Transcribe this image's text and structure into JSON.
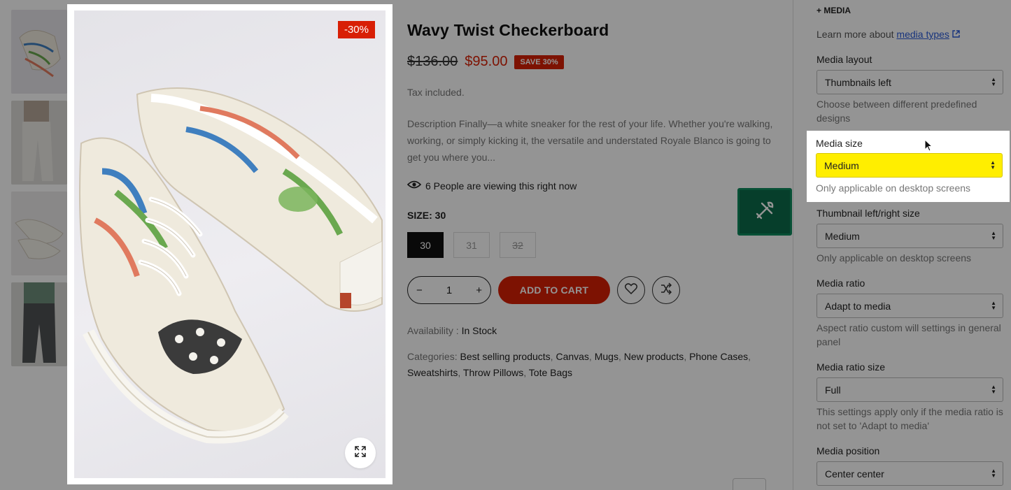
{
  "product": {
    "title": "Wavy Twist Checkerboard",
    "badge": "-30%",
    "price_old": "$136.00",
    "price_new": "$95.00",
    "save_badge": "SAVE 30%",
    "tax": "Tax included.",
    "description": "Description Finally—a white sneaker for the rest of your life. Whether you're walking, working, or simply kicking it, the versatile and understated Royale Blanco is going to get you where you...",
    "viewing": "6 People are viewing this right now",
    "size_label": "SIZE: 30",
    "sizes": [
      {
        "label": "30",
        "state": "active"
      },
      {
        "label": "31",
        "state": "available"
      },
      {
        "label": "32",
        "state": "unavailable"
      }
    ],
    "qty_minus": "−",
    "quantity": "1",
    "qty_plus": "+",
    "add_to_cart": "ADD TO CART",
    "availability_label": "Availability :",
    "availability_value": "In Stock",
    "categories_label": "Categories:",
    "categories": [
      "Best selling products",
      "Canvas",
      "Mugs",
      "New products",
      "Phone Cases",
      "Sweatshirts",
      "Throw Pillows",
      "Tote Bags"
    ]
  },
  "panel": {
    "heading": "+ MEDIA",
    "learn_text": "Learn more about",
    "learn_link": "media types",
    "fields": [
      {
        "label": "Media layout",
        "value": "Thumbnails left",
        "help": "Choose between different predefined designs"
      },
      {
        "label": "Media size",
        "value": "Medium",
        "help": "Only applicable on desktop screens",
        "highlighted": true
      },
      {
        "label": "Thumbnail left/right size",
        "value": "Medium",
        "help": "Only applicable on desktop screens"
      },
      {
        "label": "Media ratio",
        "value": "Adapt to media",
        "help": "Aspect ratio custom will settings in general panel"
      },
      {
        "label": "Media ratio size",
        "value": "Full",
        "help": "This settings apply only if the media ratio is not set to 'Adapt to media'"
      },
      {
        "label": "Media position",
        "value": "Center center",
        "help": ""
      }
    ]
  },
  "colors": {
    "accent_red": "#d81f05",
    "highlight_yellow": "#ffee00",
    "tool_green": "#0b6b4a",
    "link_blue": "#2a5bd7"
  },
  "icons": [
    "external-link-icon",
    "eye-icon",
    "heart-icon",
    "compare-icon",
    "expand-icon",
    "tools-icon",
    "cursor-icon"
  ]
}
